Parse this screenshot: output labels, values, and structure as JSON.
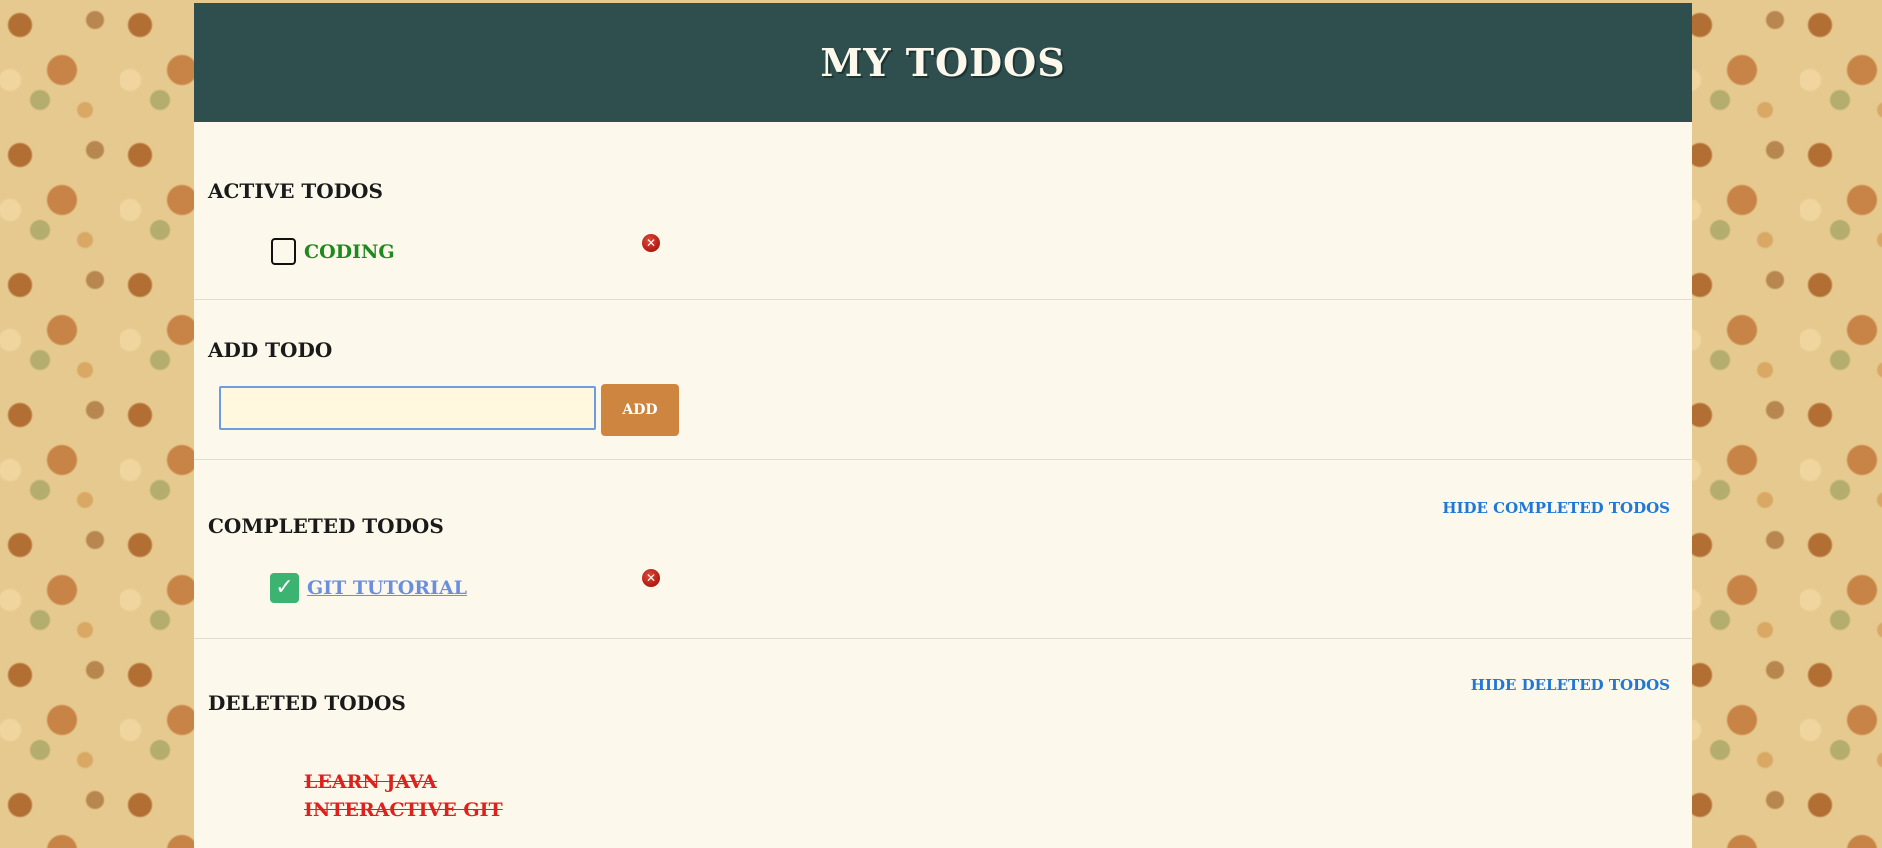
{
  "header": {
    "title": "MY TODOS"
  },
  "active": {
    "heading": "ACTIVE TODOS",
    "items": [
      {
        "label": "CODING"
      }
    ]
  },
  "add": {
    "heading": "ADD TODO",
    "input_value": "",
    "input_placeholder": "",
    "button_label": "ADD"
  },
  "completed": {
    "heading": "COMPLETED TODOS",
    "toggle_label": "HIDE COMPLETED TODOS",
    "items": [
      {
        "label": "GIT TUTORIAL"
      }
    ]
  },
  "deleted": {
    "heading": "DELETED TODOS",
    "toggle_label": "HIDE DELETED TODOS",
    "items": [
      {
        "label": "LEARN JAVA"
      },
      {
        "label": "INTERACTIVE GIT"
      }
    ]
  },
  "icons": {
    "checkmark": "✓",
    "delete": "✕"
  },
  "colors": {
    "header_bg": "#2f4f4f",
    "panel_bg": "#fdf8ec",
    "add_button": "#cd853f",
    "active_text": "#1e8a1e",
    "completed_text": "#6b8fe0",
    "deleted_text": "#e0201a",
    "link": "#1e78d6",
    "checked_box": "#3cb371"
  }
}
